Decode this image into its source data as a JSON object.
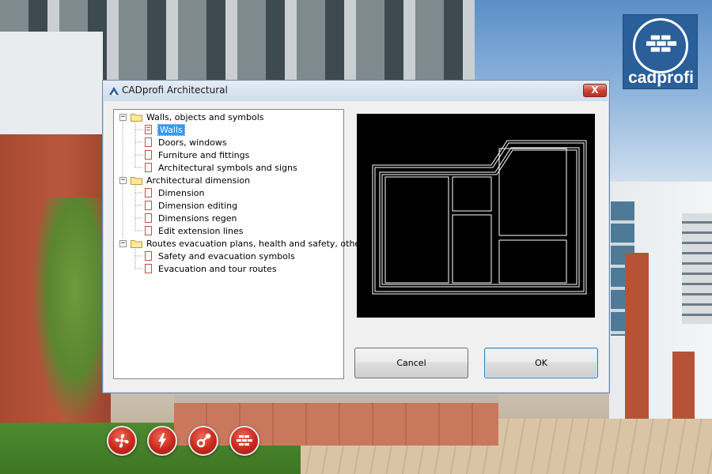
{
  "logo": {
    "text": "cadprofi",
    "icon": "brick-wall-icon",
    "color": "#2a5f99"
  },
  "dialog": {
    "title": "CADprofi Architectural",
    "close_symbol": "X",
    "tree": [
      {
        "label": "Walls, objects and symbols",
        "type": "folder",
        "expander": "−"
      },
      {
        "label": "Walls",
        "type": "item",
        "selected": true
      },
      {
        "label": "Doors, windows",
        "type": "item"
      },
      {
        "label": "Furniture and fittings",
        "type": "item"
      },
      {
        "label": "Architectural symbols and signs",
        "type": "item"
      },
      {
        "label": "Architectural dimension",
        "type": "folder",
        "expander": "−"
      },
      {
        "label": "Dimension",
        "type": "item"
      },
      {
        "label": "Dimension editing",
        "type": "item"
      },
      {
        "label": "Dimensions regen",
        "type": "item"
      },
      {
        "label": "Edit extension lines",
        "type": "item"
      },
      {
        "label": "Routes evacuation plans, health and safety, others",
        "type": "folder",
        "expander": "−"
      },
      {
        "label": "Safety and evacuation symbols",
        "type": "item"
      },
      {
        "label": "Evacuation and tour routes",
        "type": "item"
      }
    ],
    "buttons": {
      "cancel": "Cancel",
      "ok": "OK"
    }
  },
  "toolbar_icons": [
    "fan-icon",
    "lightning-icon",
    "pipe-fitting-icon",
    "brick-wall-icon"
  ],
  "colors": {
    "selection": "#3399ff",
    "round_button": "#c8291c"
  }
}
